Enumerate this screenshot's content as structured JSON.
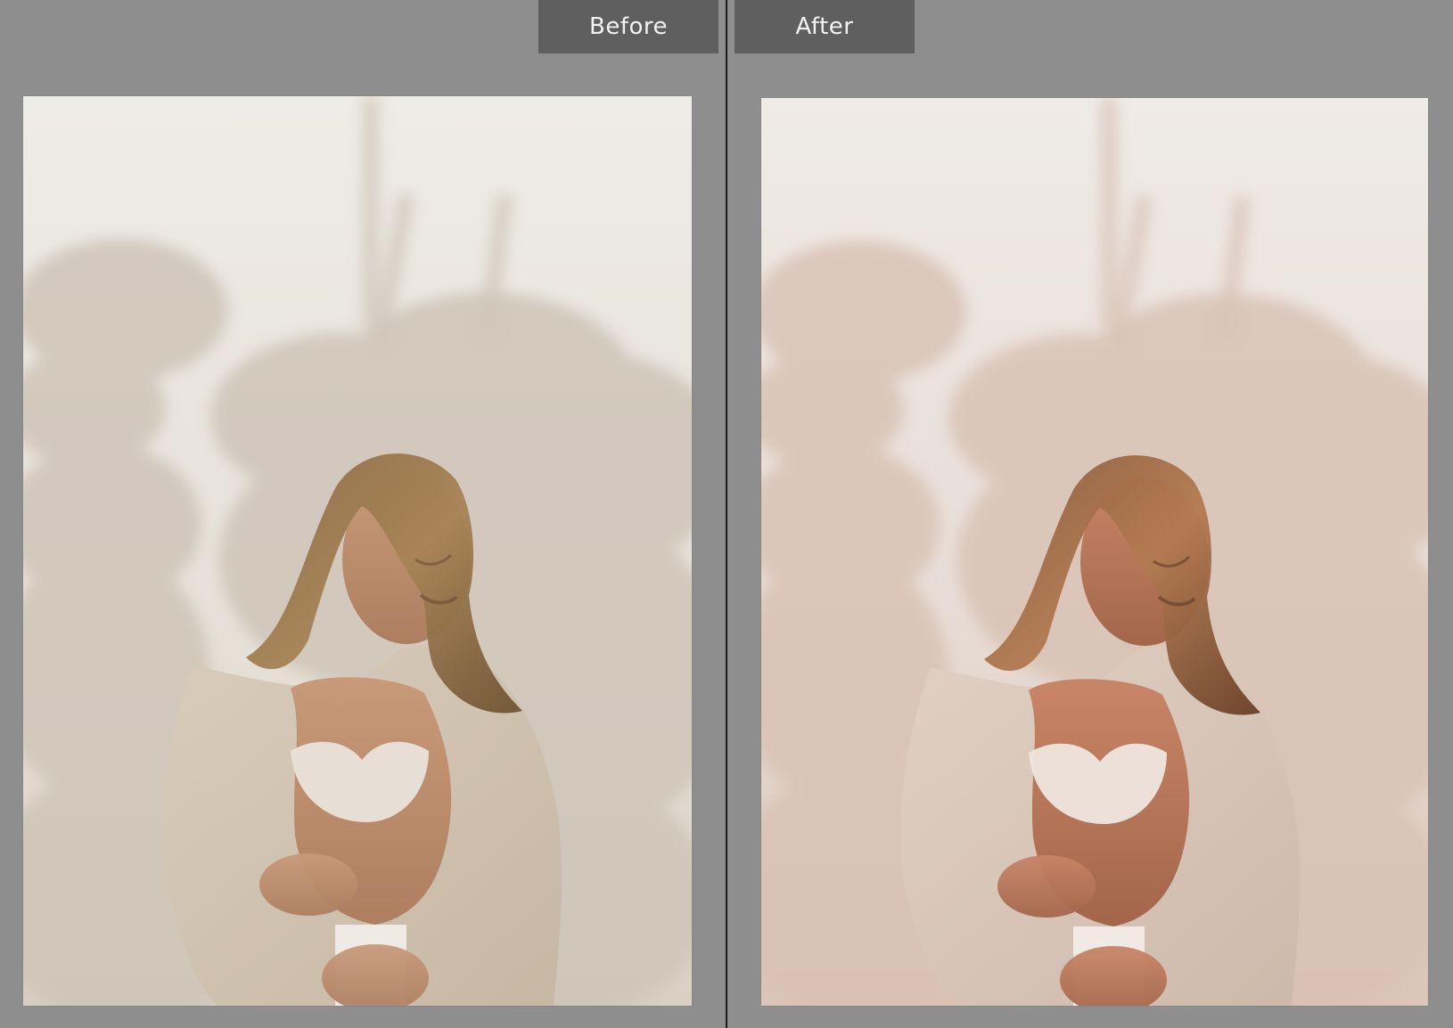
{
  "compare_view": {
    "before_label": "Before",
    "after_label": "After"
  },
  "colors": {
    "background": "#8c8c8c",
    "label_bg": "#5f5f5f",
    "label_text": "#f2f2f2",
    "divider": "#1b1b1b"
  }
}
